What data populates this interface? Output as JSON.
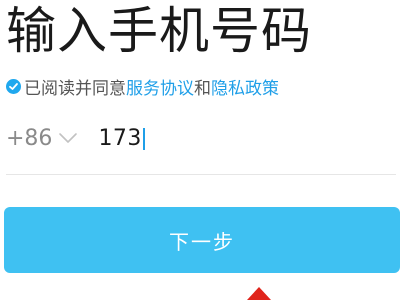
{
  "screen": {
    "title": "输入手机号码"
  },
  "agreement": {
    "prefix": "已阅读并同意",
    "terms_link": "服务协议",
    "joiner": "和",
    "privacy_link": "隐私政策",
    "checked": true
  },
  "phone": {
    "country_code": "+86",
    "value": "173"
  },
  "buttons": {
    "next_label": "下一步"
  },
  "colors": {
    "accent": "#1f9fe8",
    "button": "#3fc1f2",
    "arrow": "#e0241b"
  }
}
